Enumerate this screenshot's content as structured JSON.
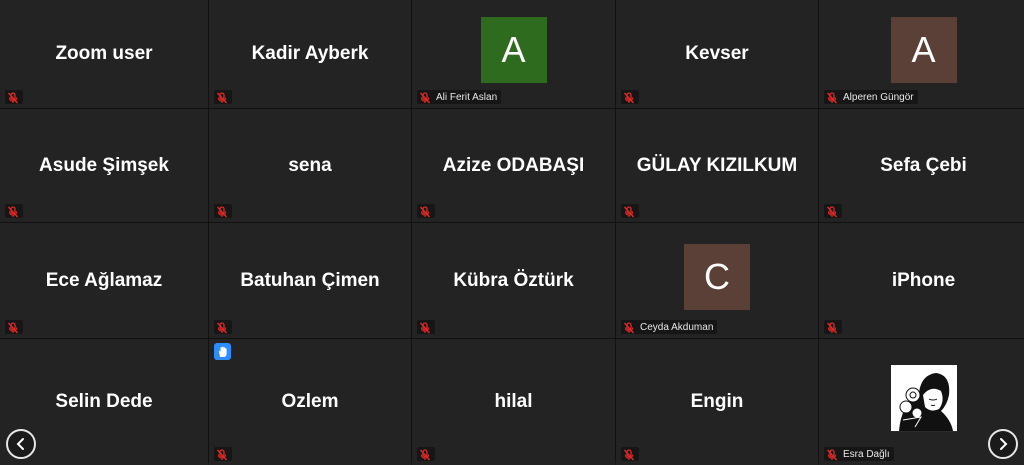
{
  "colors": {
    "tile_bg": "#232323",
    "mute_red": "#e02828",
    "raise_hand_blue": "#2d8cff"
  },
  "participants": [
    {
      "display": "Zoom user",
      "type": "name",
      "muted": true
    },
    {
      "display": "Kadir Ayberk",
      "type": "name",
      "muted": true
    },
    {
      "display": "A",
      "type": "avatar",
      "avatar_color": "#2f6b1e",
      "footer_name": "Ali Ferit Aslan",
      "muted": true
    },
    {
      "display": "Kevser",
      "type": "name",
      "muted": true
    },
    {
      "display": "A",
      "type": "avatar",
      "avatar_color": "#5a4036",
      "footer_name": "Alperen Güngör",
      "muted": true
    },
    {
      "display": "Asude Şimşek",
      "type": "name",
      "muted": true
    },
    {
      "display": "sena",
      "type": "name",
      "muted": true
    },
    {
      "display": "Azize ODABAŞI",
      "type": "name",
      "muted": true
    },
    {
      "display": "GÜLAY KIZILKUM",
      "type": "name",
      "muted": true
    },
    {
      "display": "Sefa Çebi",
      "type": "name",
      "muted": true
    },
    {
      "display": "Ece Ağlamaz",
      "type": "name",
      "muted": true
    },
    {
      "display": "Batuhan Çimen",
      "type": "name",
      "muted": true
    },
    {
      "display": "Kübra Öztürk",
      "type": "name",
      "muted": true
    },
    {
      "display": "C",
      "type": "avatar",
      "avatar_color": "#5a4036",
      "footer_name": "Ceyda Akduman",
      "muted": true
    },
    {
      "display": "iPhone",
      "type": "name",
      "muted": true
    },
    {
      "display": "Selin Dede",
      "type": "name",
      "muted": false
    },
    {
      "display": "Ozlem",
      "type": "name",
      "muted": true,
      "hand_raised": true
    },
    {
      "display": "hilal",
      "type": "name",
      "muted": true
    },
    {
      "display": "Engin",
      "type": "name",
      "muted": true
    },
    {
      "display": "",
      "type": "photo",
      "footer_name": "Esra Dağlı",
      "muted": true
    }
  ],
  "icons": {
    "mute": "microphone-muted-icon",
    "hand": "raised-hand-icon",
    "prev": "chevron-left-icon",
    "next": "chevron-right-icon",
    "photo": "profile-photo"
  }
}
